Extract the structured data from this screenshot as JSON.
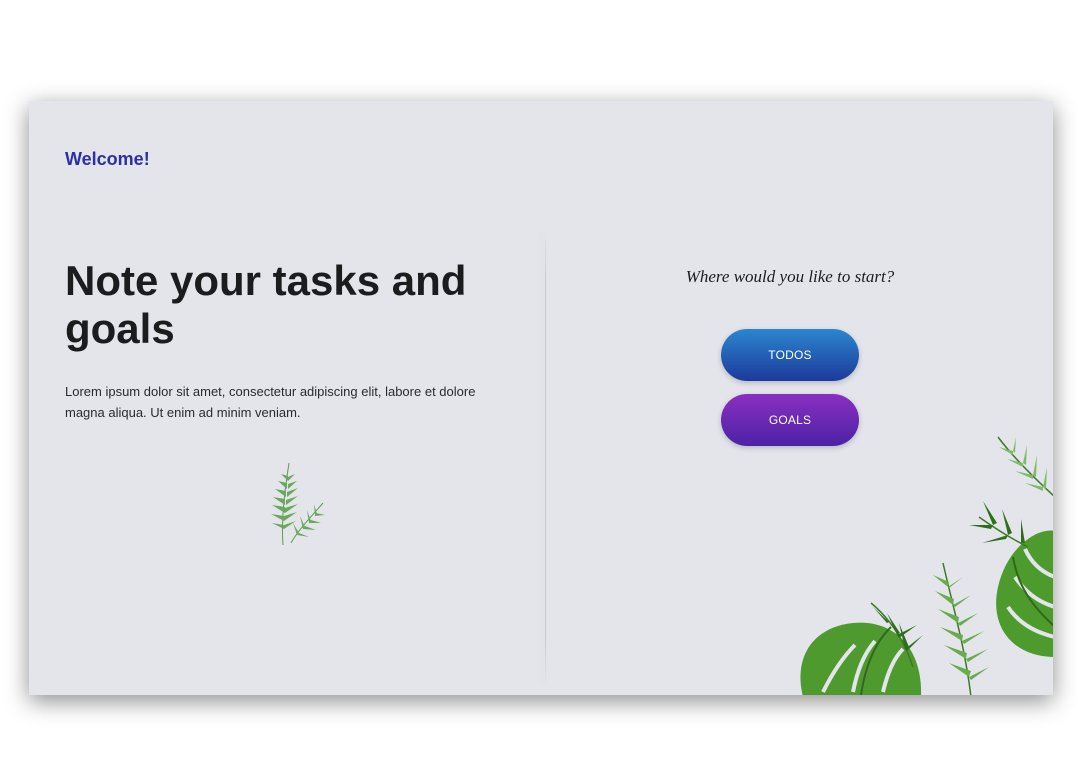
{
  "header": {
    "welcome": "Welcome!"
  },
  "hero": {
    "headline": "Note your tasks and goals",
    "description": "Lorem ipsum dolor sit amet, consectetur adipiscing elit, labore et dolore magna aliqua. Ut enim ad minim veniam."
  },
  "start": {
    "prompt": "Where would you like to start?",
    "todos_label": "TODOS",
    "goals_label": "GOALS"
  },
  "colors": {
    "accent": "#2c2fa8",
    "todos_gradient": [
      "#2b86cf",
      "#1c3a9a"
    ],
    "goals_gradient": [
      "#8a2fc2",
      "#4b22a5"
    ],
    "card_bg": "#e4e5ea"
  },
  "decorations": [
    "palm-sprig-illustration",
    "tropical-leaves-illustration"
  ]
}
